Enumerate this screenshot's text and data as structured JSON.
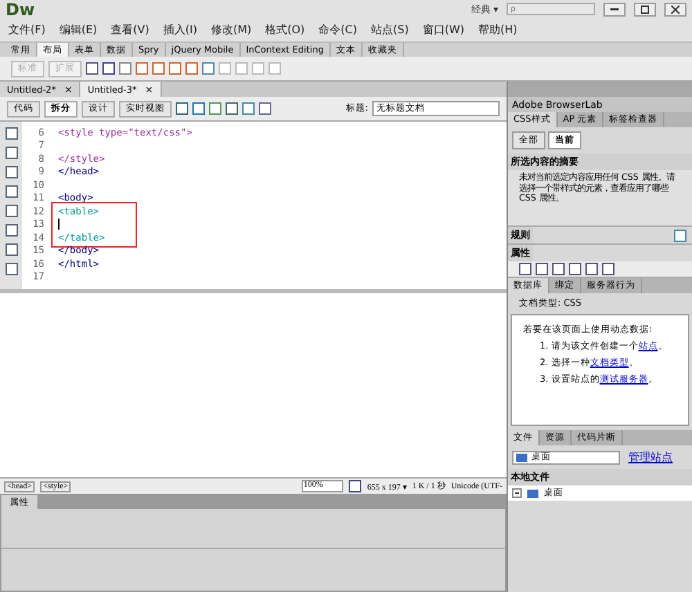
{
  "window": {
    "logo": "Dw",
    "workspace": "经典 ▾",
    "search": {
      "placeholder": "ρ"
    }
  },
  "menu": [
    "文件(F)",
    "编辑(E)",
    "查看(V)",
    "插入(I)",
    "修改(M)",
    "格式(O)",
    "命令(C)",
    "站点(S)",
    "窗口(W)",
    "帮助(H)"
  ],
  "insert_tabs": [
    {
      "label": "常用",
      "selected": false
    },
    {
      "label": "布局",
      "selected": true
    },
    {
      "label": "表单",
      "selected": false
    },
    {
      "label": "数据",
      "selected": false
    },
    {
      "label": "Spry",
      "selected": false
    },
    {
      "label": "jQuery Mobile",
      "selected": false
    },
    {
      "label": "InContext Editing",
      "selected": false
    },
    {
      "label": "文本",
      "selected": false
    },
    {
      "label": "收藏夹",
      "selected": false
    }
  ],
  "layout_toolbar": {
    "buttons": [
      {
        "label": "标准",
        "disabled": true
      },
      {
        "label": "扩展",
        "disabled": true
      }
    ]
  },
  "doc_tabs": [
    {
      "label": "Untitled-2*",
      "close": "×",
      "selected": false
    },
    {
      "label": "Untitled-3*",
      "close": "×",
      "selected": true
    }
  ],
  "doc_toolbar": {
    "views": [
      {
        "label": "代码",
        "selected": false
      },
      {
        "label": "拆分",
        "selected": true
      },
      {
        "label": "设计",
        "selected": false
      },
      {
        "label": "实时视图",
        "selected": false
      }
    ],
    "title_label": "标题:",
    "title_value": "无标题文档"
  },
  "code_lines": [
    {
      "number": "6",
      "text": "<style type=\"text/css\">",
      "color": "#993399",
      "highlighted": false,
      "cursor": false
    },
    {
      "number": "7",
      "highlighted": false,
      "cursor": false
    },
    {
      "number": "8",
      "text": "</style>",
      "color": "#993399",
      "highlighted": false,
      "cursor": false
    },
    {
      "number": "9",
      "text": "</head>",
      "color": "#000080",
      "highlighted": false,
      "cursor": false
    },
    {
      "number": "10",
      "highlighted": false,
      "cursor": false
    },
    {
      "number": "11",
      "text": "<body>",
      "color": "#000080",
      "highlighted": false,
      "cursor": false
    },
    {
      "number": "12",
      "text": "<table>",
      "color": "#009999",
      "highlighted": true,
      "cursor": false
    },
    {
      "number": "13",
      "highlighted": true,
      "cursor": true
    },
    {
      "number": "14",
      "text": "</table>",
      "color": "#009999",
      "highlighted": true,
      "cursor": false
    },
    {
      "number": "15",
      "text": "</body>",
      "color": "#000080",
      "highlighted": false,
      "cursor": false
    },
    {
      "number": "16",
      "text": "</html>",
      "color": "#000080",
      "highlighted": false,
      "cursor": false
    },
    {
      "number": "17",
      "highlighted": false,
      "cursor": false
    }
  ],
  "status_bar": {
    "tags": [
      "<head>",
      "<style>"
    ],
    "zoom": "100%",
    "size": "655 x 197 ▾",
    "download": "1 K / 1 秒",
    "encoding": "Unicode (UTF-"
  },
  "properties_panel": {
    "title": "属性"
  },
  "right_panel": {
    "browserlab": "Adobe BrowserLab",
    "css_tabs": [
      {
        "label": "CSS样式",
        "selected": true
      },
      {
        "label": "AP 元素",
        "selected": false
      },
      {
        "label": "标签检查器",
        "selected": false
      }
    ],
    "mode_tabs": [
      {
        "label": "全部",
        "selected": false
      },
      {
        "label": "当前",
        "selected": true
      }
    ],
    "summary_title": "所选内容的摘要",
    "summary_text": "未对当前选定内容应用任何 CSS 属性。请选择一个带样式的元素，查看应用了哪些 CSS 属性。",
    "rules_title": "规则",
    "props_title": "属性",
    "data_tabs": [
      {
        "label": "数据库",
        "selected": true
      },
      {
        "label": "绑定",
        "selected": false
      },
      {
        "label": "服务器行为",
        "selected": false
      }
    ],
    "doc_type": "文档类型: CSS",
    "intro": "若要在该页面上使用动态数据:",
    "steps": [
      {
        "number": "1.",
        "text": "请为该文件创建一个",
        "link": "站点",
        "end": "。"
      },
      {
        "number": "2.",
        "text": "选择一种",
        "link": "文档类型",
        "end": "。"
      },
      {
        "number": "3.",
        "text": "设置站点的",
        "link": "测试服务器",
        "end": "。"
      }
    ],
    "file_tabs": [
      {
        "label": "文件",
        "selected": true
      },
      {
        "label": "资源",
        "selected": false
      },
      {
        "label": "代码片断",
        "selected": false
      }
    ],
    "site_select": "桌面",
    "manage_link": "管理站点",
    "local_files": "本地文件",
    "tree_items": [
      {
        "label": "桌面",
        "expanded": true
      }
    ]
  }
}
